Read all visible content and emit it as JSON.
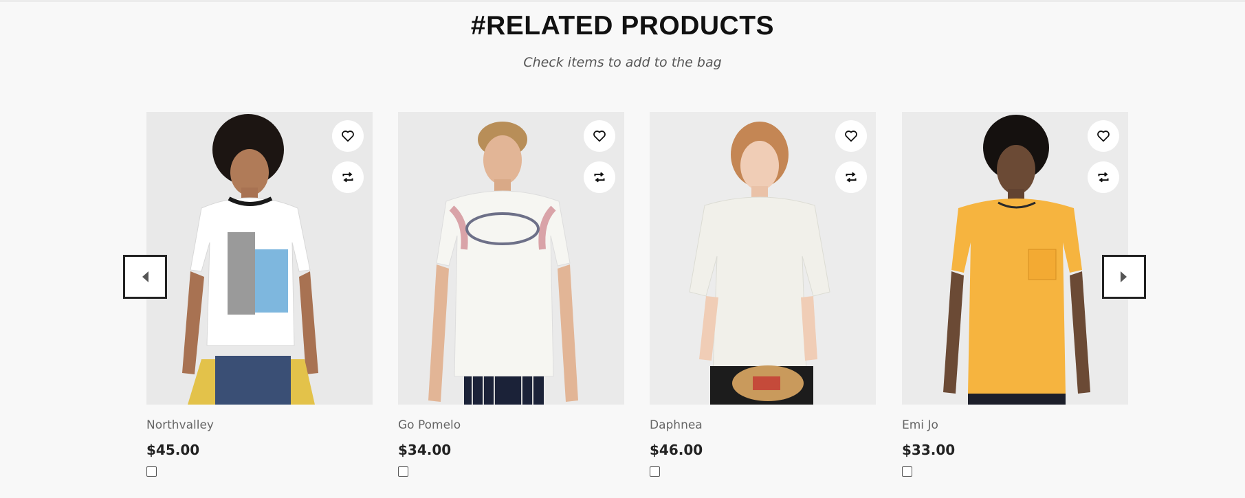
{
  "section": {
    "title": "#RELATED PRODUCTS",
    "subtitle": "Check items to add to the bag"
  },
  "carousel": {
    "prev_icon": "chevron-left-icon",
    "next_icon": "chevron-right-icon"
  },
  "products": [
    {
      "name": "Northvalley",
      "price": "$45.00",
      "shirt_color": "#ffffff",
      "checked": false
    },
    {
      "name": "Go Pomelo",
      "price": "$34.00",
      "shirt_color": "#f6f6f2",
      "checked": false
    },
    {
      "name": "Daphnea",
      "price": "$46.00",
      "shirt_color": "#f1f0ea",
      "checked": false
    },
    {
      "name": "Emi Jo",
      "price": "$33.00",
      "shirt_color": "#f6b43f",
      "checked": false
    }
  ],
  "icons": {
    "wishlist": "heart-icon",
    "compare": "compare-arrows-icon"
  }
}
